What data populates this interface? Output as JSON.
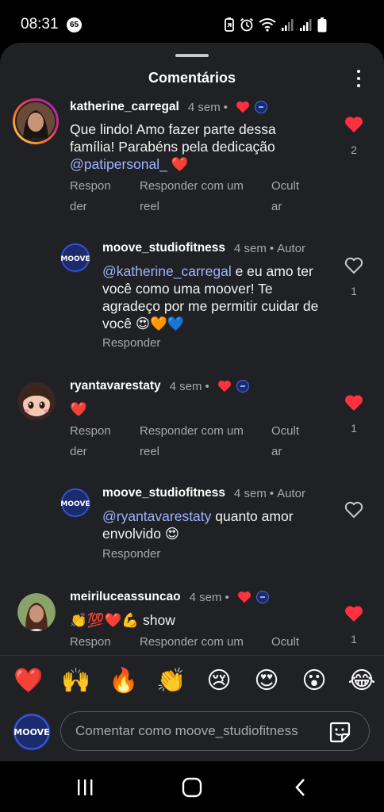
{
  "status_bar": {
    "time": "08:31",
    "notification_count": "65",
    "icons": [
      "battery-saver-icon",
      "alarm-icon",
      "wifi-icon",
      "signal-icon",
      "signal-icon",
      "battery-icon"
    ]
  },
  "sheet": {
    "title": "Comentários"
  },
  "comments": [
    {
      "username": "katherine_carregal",
      "time": "4 sem",
      "dot": "•",
      "text": "Que lindo! Amo fazer parte dessa família! Parabéns pela dedicação ",
      "mention": "@patipersonal_",
      "suffix": " ❤️",
      "likes": "2",
      "liked": true,
      "actions": {
        "reply": "Respon\nder",
        "reply_reel": "Responder com um\nreel",
        "hide": "Ocult\nar"
      }
    },
    {
      "username": "moove_studiofitness",
      "time": "4 sem",
      "dot": "•",
      "author": "Autor",
      "mention": "@katherine_carregal",
      "text": " e eu amo ter você como uma moover!  Te agradeço por me permitir cuidar de você 😍🧡💙",
      "likes": "1",
      "liked": false,
      "actions": {
        "reply": "Responder"
      }
    },
    {
      "username": "ryantavarestaty",
      "time": "4 sem",
      "dot": "•",
      "text": "❤️",
      "likes": "1",
      "liked": true,
      "actions": {
        "reply": "Respon\nder",
        "reply_reel": "Responder com um\nreel",
        "hide": "Ocult\nar"
      }
    },
    {
      "username": "moove_studiofitness",
      "time": "4 sem",
      "dot": "•",
      "author": "Autor",
      "mention": "@ryantavarestaty",
      "text": " quanto amor envolvido 😍",
      "likes": "",
      "liked": false,
      "actions": {
        "reply": "Responder"
      }
    },
    {
      "username": "meiriluceassuncao",
      "time": "4 sem",
      "dot": "•",
      "text": "👏💯❤️💪 show",
      "likes": "1",
      "liked": true,
      "actions": {
        "reply": "Respon",
        "reply_reel": "Responder com um",
        "hide": "Ocult"
      }
    }
  ],
  "quick_reactions": [
    "❤️",
    "🙌",
    "🔥",
    "👏",
    "😢",
    "😍",
    "😮",
    "😂"
  ],
  "composer": {
    "placeholder": "Comentar como moove_studiofitness"
  },
  "colors": {
    "background": "#202124",
    "like_red": "#ff3040",
    "mention_blue": "#9db4ff",
    "secondary_text": "#a8a8a8"
  }
}
